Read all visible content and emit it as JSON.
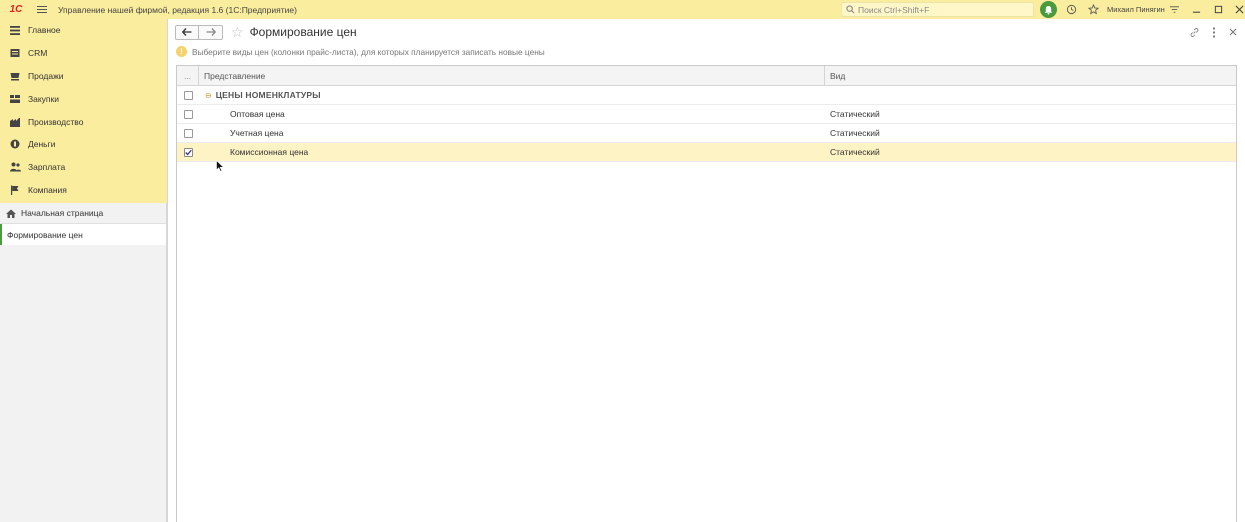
{
  "titlebar": {
    "logo": "1С",
    "app_title": "Управление нашей фирмой, редакция 1.6  (1С:Предприятие)",
    "search_placeholder": "Поиск Ctrl+Shift+F",
    "user": "Михаил Пинягин"
  },
  "sidebar": {
    "items": [
      {
        "label": "Главное",
        "icon": "menu-lines-icon"
      },
      {
        "label": "CRM",
        "icon": "crm-icon"
      },
      {
        "label": "Продажи",
        "icon": "cart-icon"
      },
      {
        "label": "Закупки",
        "icon": "purchase-icon"
      },
      {
        "label": "Производство",
        "icon": "factory-icon"
      },
      {
        "label": "Деньги",
        "icon": "coin-icon"
      },
      {
        "label": "Зарплата",
        "icon": "people-icon"
      },
      {
        "label": "Компания",
        "icon": "flag-icon"
      }
    ],
    "open_windows": {
      "home": "Начальная страница",
      "active": "Формирование цен"
    }
  },
  "form": {
    "title": "Формирование цен",
    "hint": "Выберите виды цен (колонки прайс-листа), для которых планируется записать новые цены"
  },
  "grid": {
    "columns": [
      "...",
      "Представление",
      "Вид"
    ],
    "group": {
      "label": "ЦЕНЫ НОМЕНКЛАТУРЫ",
      "toggle": "⊖"
    },
    "rows": [
      {
        "name": "Оптовая цена",
        "kind": "Статический",
        "checked": false
      },
      {
        "name": "Учетная цена",
        "kind": "Статический",
        "checked": false
      },
      {
        "name": "Комиссионная цена",
        "kind": "Статический",
        "checked": true
      }
    ]
  },
  "colors": {
    "accent_yellow": "#fbed9e",
    "selected_row": "#fdf3c4",
    "green": "#4a9b3e"
  }
}
